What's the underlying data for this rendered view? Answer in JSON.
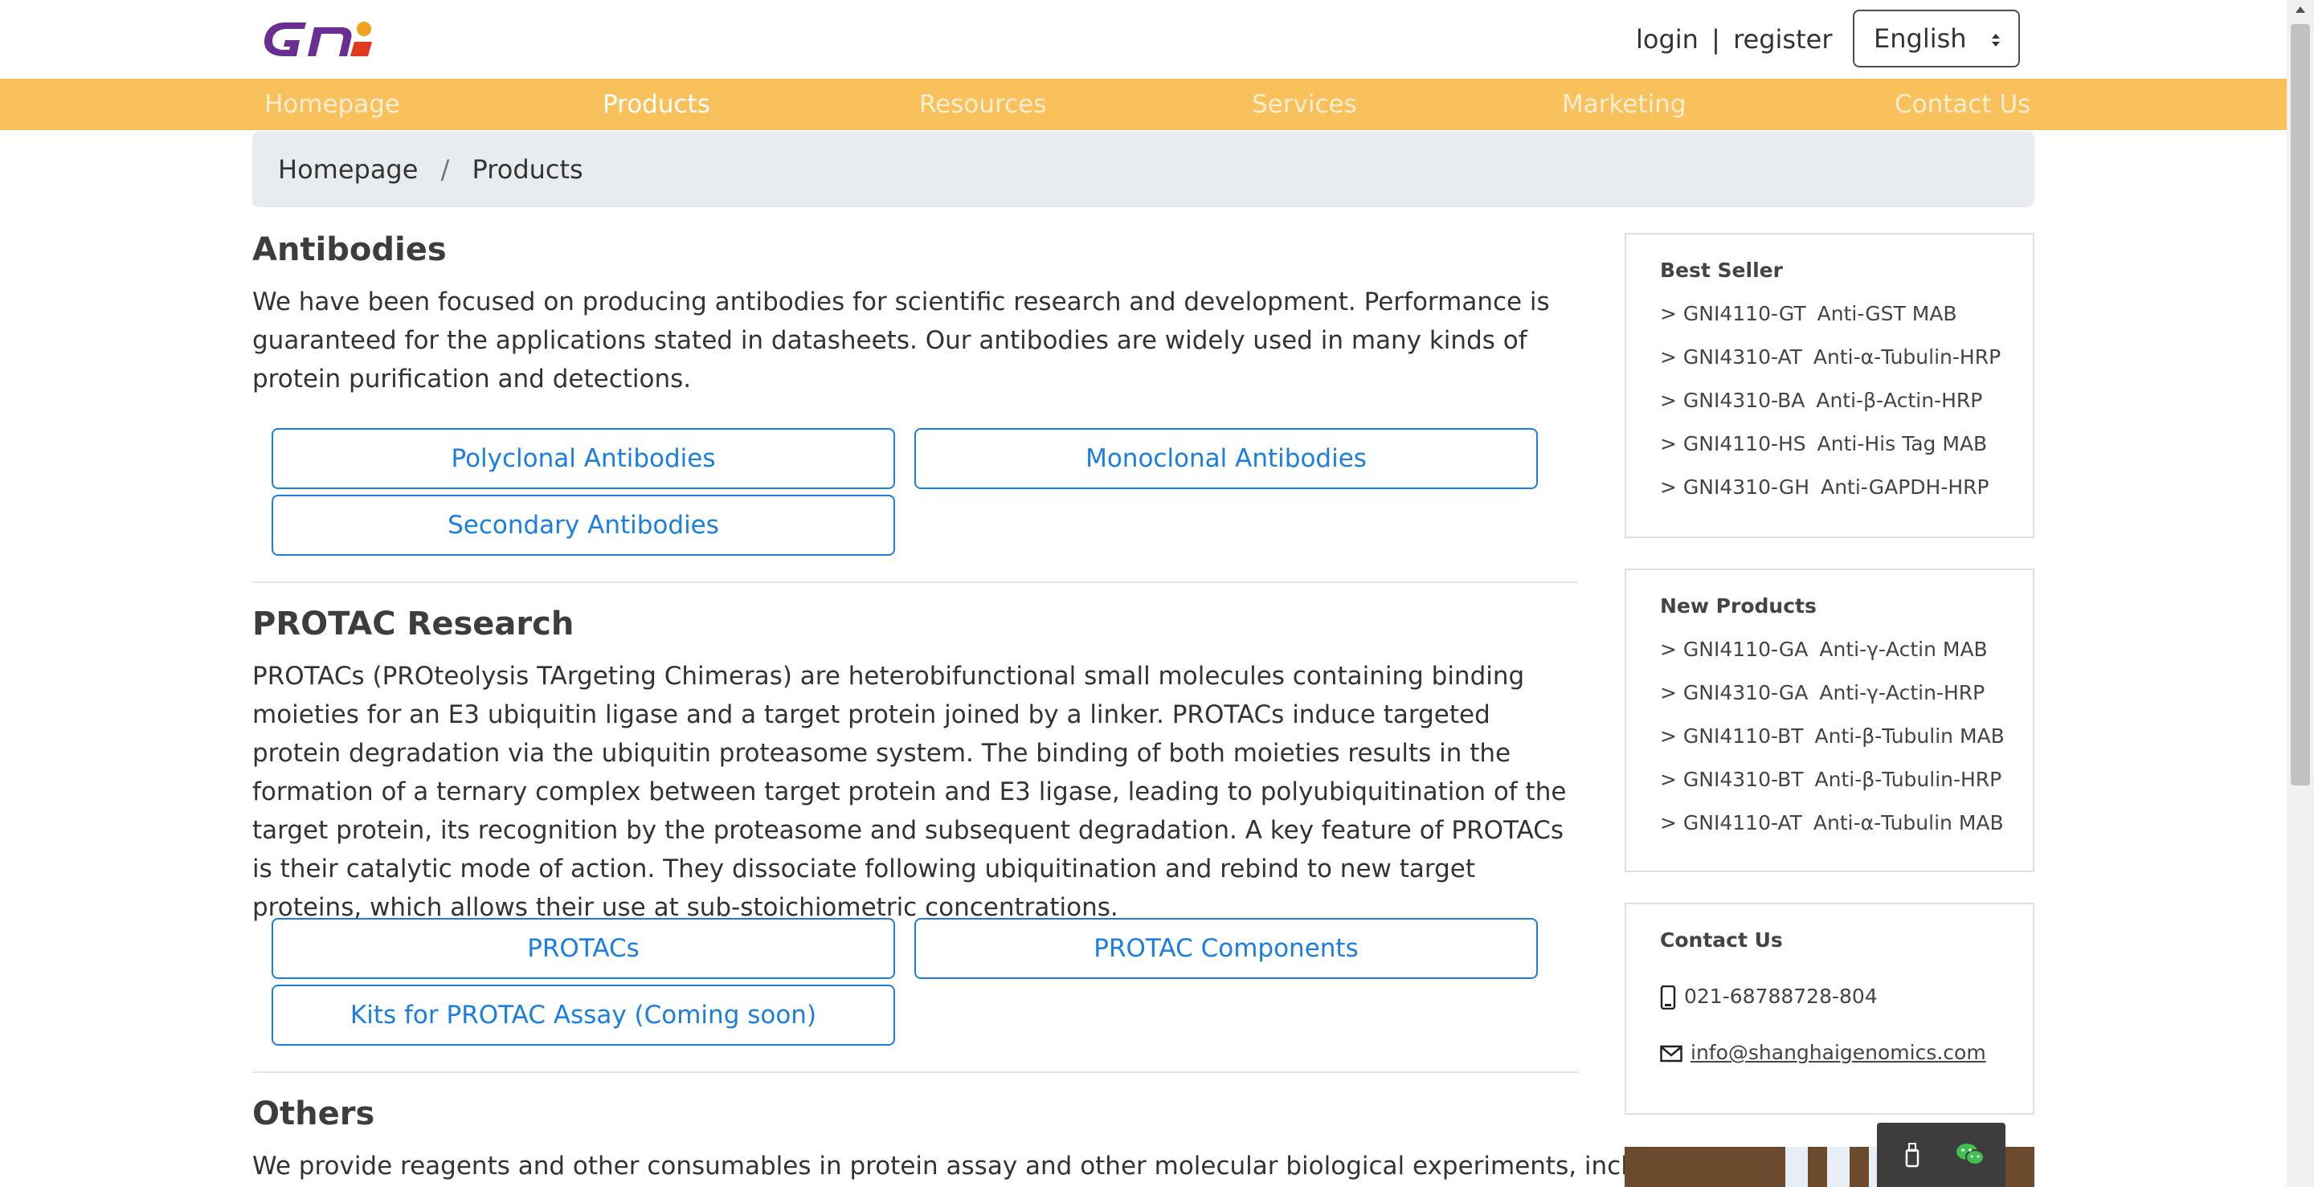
{
  "header": {
    "logo_text": "GNI",
    "login_label": "login",
    "separator": "|",
    "register_label": "register",
    "language": "English"
  },
  "nav": {
    "items": [
      {
        "label": "Homepage"
      },
      {
        "label": "Products",
        "active": true
      },
      {
        "label": "Resources"
      },
      {
        "label": "Services"
      },
      {
        "label": "Marketing"
      },
      {
        "label": "Contact Us"
      }
    ]
  },
  "breadcrumb": {
    "items": [
      {
        "label": "Homepage"
      },
      {
        "label": "Products"
      }
    ],
    "separator": "/"
  },
  "sections": [
    {
      "title": "Antibodies",
      "text": "We have been focused on producing antibodies for scientific research and development. Performance is guaranteed for the applications stated in datasheets. Our antibodies are widely used in many kinds of protein purification and detections.",
      "buttons": [
        {
          "label": "Polyclonal Antibodies"
        },
        {
          "label": "Monoclonal Antibodies"
        },
        {
          "label": "Secondary Antibodies"
        }
      ]
    },
    {
      "title": "PROTAC Research",
      "text": "PROTACs (PROteolysis TArgeting Chimeras) are heterobifunctional small molecules containing binding moieties for an E3 ubiquitin ligase and a target protein joined by a linker. PROTACs induce targeted protein degradation via the ubiquitin proteasome system. The binding of both moieties results in the formation of a ternary complex between target protein and E3 ligase, leading to polyubiquitination of the target protein, its recognition by the proteasome and subsequent degradation. A key feature of PROTACs is their catalytic mode of action. They dissociate following ubiquitination and rebind to new target proteins, which allows their use at sub-stoichiometric concentrations.",
      "buttons": [
        {
          "label": "PROTACs"
        },
        {
          "label": "PROTAC Components"
        },
        {
          "label": "Kits for PROTAC Assay (Coming soon)"
        }
      ]
    },
    {
      "title": "Others",
      "text": "We provide reagents and other consumables in protein assay and other molecular biological experiments, including"
    }
  ],
  "sidebar": {
    "best_seller": {
      "title": "Best Seller",
      "items": [
        {
          "prefix": ">",
          "code": "GNI4110-GT",
          "name": "Anti-GST MAB"
        },
        {
          "prefix": ">",
          "code": "GNI4310-AT",
          "name": "Anti-α-Tubulin-HRP"
        },
        {
          "prefix": ">",
          "code": "GNI4310-BA",
          "name": "Anti-β-Actin-HRP"
        },
        {
          "prefix": ">",
          "code": "GNI4110-HS",
          "name": "Anti-His Tag MAB"
        },
        {
          "prefix": ">",
          "code": "GNI4310-GH",
          "name": "Anti-GAPDH-HRP"
        }
      ]
    },
    "new_products": {
      "title": "New Products",
      "items": [
        {
          "prefix": ">",
          "code": "GNI4110-GA",
          "name": "Anti-γ-Actin MAB"
        },
        {
          "prefix": ">",
          "code": "GNI4310-GA",
          "name": "Anti-γ-Actin-HRP"
        },
        {
          "prefix": ">",
          "code": "GNI4110-BT",
          "name": "Anti-β-Tubulin MAB"
        },
        {
          "prefix": ">",
          "code": "GNI4310-BT",
          "name": "Anti-β-Tubulin-HRP"
        },
        {
          "prefix": ">",
          "code": "GNI4110-AT",
          "name": "Anti-α-Tubulin MAB"
        }
      ]
    },
    "contact": {
      "title": "Contact Us",
      "phone": "021-68788728-804",
      "email": "info@shanghaigenomics.com"
    }
  },
  "icons": {
    "phone": "phone-icon",
    "email": "mail-icon",
    "language_caret": "select-caret-icon",
    "floating_1": "usb-icon",
    "floating_2": "wechat-icon"
  },
  "colors": {
    "nav_bg": "#f8c15c",
    "link_blue": "#1a7fe0",
    "breadcrumb_bg": "#e9ecef",
    "logo_purple": "#6a2d91"
  }
}
